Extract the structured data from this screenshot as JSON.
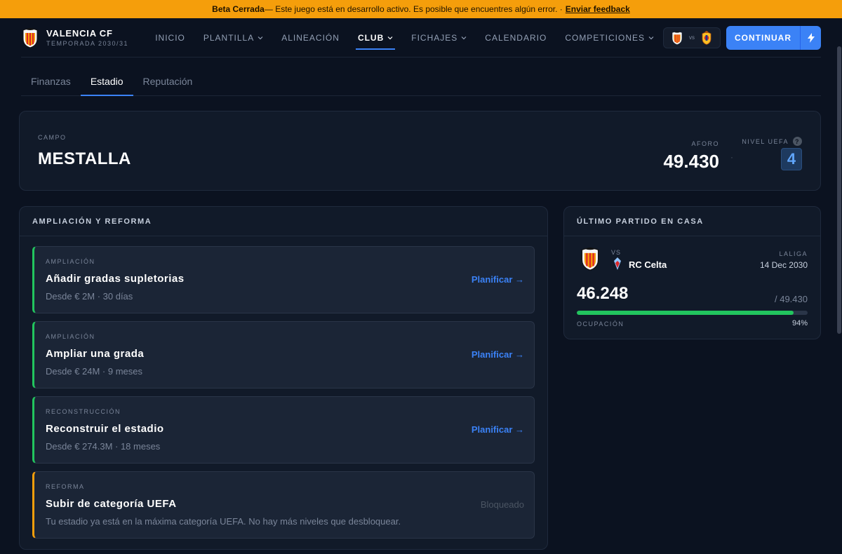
{
  "banner": {
    "strong": "Beta Cerrada",
    "text": " — Este juego está en desarrollo activo. Es posible que encuentres algún error. ·",
    "link": "Enviar feedback"
  },
  "brand": {
    "name": "VALENCIA CF",
    "season": "TEMPORADA 2030/31"
  },
  "nav": [
    {
      "label": "INICIO",
      "dropdown": false,
      "active": false
    },
    {
      "label": "PLANTILLA",
      "dropdown": true,
      "active": false
    },
    {
      "label": "ALINEACIÓN",
      "dropdown": false,
      "active": false
    },
    {
      "label": "CLUB",
      "dropdown": true,
      "active": true
    },
    {
      "label": "FICHAJES",
      "dropdown": true,
      "active": false
    },
    {
      "label": "CALENDARIO",
      "dropdown": false,
      "active": false
    },
    {
      "label": "COMPETICIONES",
      "dropdown": true,
      "active": false
    }
  ],
  "next_match": {
    "vs": "vs",
    "home_icon": "valencia-crest-icon",
    "away_icon": "villarreal-crest-icon"
  },
  "continue_label": "CONTINUAR",
  "tabs": [
    "Finanzas",
    "Estadio",
    "Reputación"
  ],
  "active_tab": "Estadio",
  "stadium": {
    "campo_label": "CAMPO",
    "name": "MESTALLA",
    "aforo_label": "AFORO",
    "aforo": "49.430",
    "separator": "·",
    "uefa_label": "NIVEL UEFA",
    "help": "?",
    "uefa_level": "4"
  },
  "expansion": {
    "title": "AMPLIACIÓN Y REFORMA",
    "options": [
      {
        "category": "AMPLIACIÓN",
        "title": "Añadir gradas supletorias",
        "desc": "Desde € 2M · 30 días",
        "action": "Planificar →",
        "locked": false
      },
      {
        "category": "AMPLIACIÓN",
        "title": "Ampliar una grada",
        "desc": "Desde € 24M · 9 meses",
        "action": "Planificar →",
        "locked": false
      },
      {
        "category": "RECONSTRUCCIÓN",
        "title": "Reconstruir el estadio",
        "desc": "Desde € 274.3M · 18 meses",
        "action": "Planificar →",
        "locked": false
      },
      {
        "category": "REFORMA",
        "title": "Subir de categoría UEFA",
        "desc": "Tu estadio ya está en la máxima categoría UEFA. No hay más niveles que desbloquear.",
        "action": "Bloqueado",
        "locked": true
      }
    ]
  },
  "last_match": {
    "title": "ÚLTIMO PARTIDO EN CASA",
    "vs": "VS",
    "opponent": "RC Celta",
    "competition": "LALIGA",
    "date": "14 Dec 2030",
    "attendance": "46.248",
    "capacity": "/ 49.430",
    "occupancy_label": "OCUPACIÓN",
    "occupancy": "94%",
    "occupancy_fraction": 0.94
  },
  "colors": {
    "accent": "#3b82f6",
    "success": "#22c55e",
    "warning": "#f59e0b",
    "background": "#0b1220",
    "card": "#111a29"
  }
}
